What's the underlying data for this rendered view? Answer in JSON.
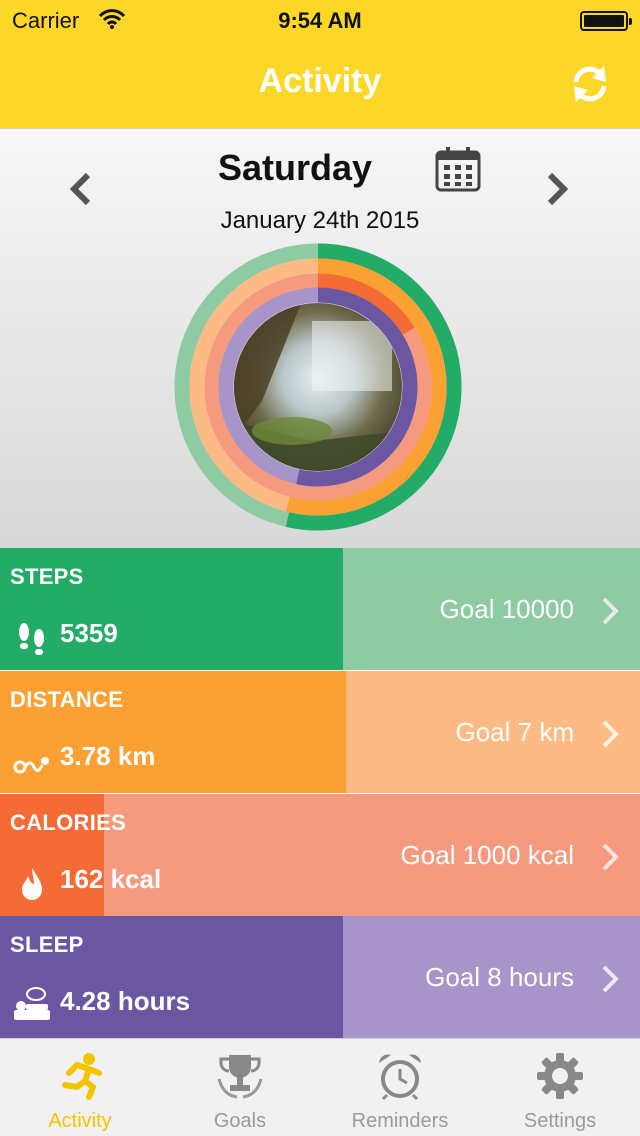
{
  "status_bar": {
    "carrier": "Carrier",
    "time": "9:54 AM"
  },
  "nav": {
    "title": "Activity",
    "sync_icon": "refresh-icon"
  },
  "day": {
    "name": "Saturday",
    "date": "January 24th 2015"
  },
  "colors": {
    "steps": "#22AC67",
    "steps_light": "#8ECBA3",
    "distance": "#FBA134",
    "distance_light": "#FEBA84",
    "calories": "#F46B36",
    "calories_light": "#F59A7F",
    "sleep": "#6A56A1",
    "sleep_light": "#A794C9",
    "accent": "#FDD727"
  },
  "metrics": {
    "steps": {
      "label": "STEPS",
      "value": "5359",
      "goal": "Goal 10000",
      "progress": 0.5359
    },
    "distance": {
      "label": "DISTANCE",
      "value": "3.78 km",
      "goal": "Goal 7 km",
      "progress": 0.54
    },
    "calories": {
      "label": "CALORIES",
      "value": "162 kcal",
      "goal": "Goal 1000 kcal",
      "progress": 0.162
    },
    "sleep": {
      "label": "SLEEP",
      "value": "4.28 hours",
      "goal": "Goal 8 hours",
      "progress": 0.535
    }
  },
  "tabs": [
    {
      "label": "Activity",
      "icon": "runner-icon",
      "active": true
    },
    {
      "label": "Goals",
      "icon": "trophy-icon",
      "active": false
    },
    {
      "label": "Reminders",
      "icon": "alarm-clock-icon",
      "active": false
    },
    {
      "label": "Settings",
      "icon": "gear-icon",
      "active": false
    }
  ]
}
